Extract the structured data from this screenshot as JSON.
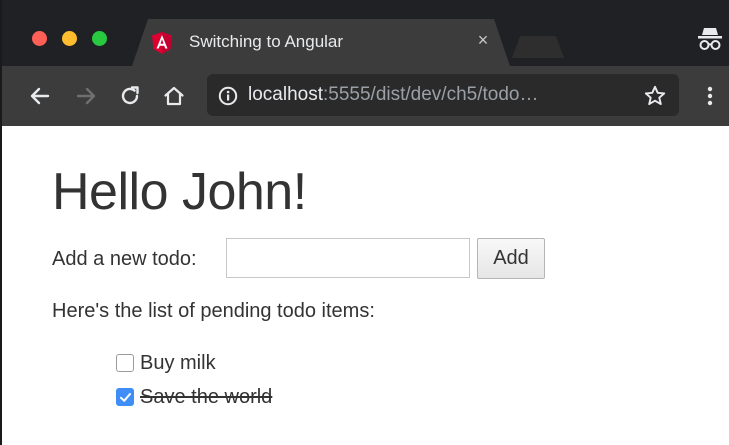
{
  "browser": {
    "tab": {
      "title": "Switching to Angular",
      "close_glyph": "×",
      "favicon": "angular-icon"
    },
    "address_bar": {
      "host": "localhost",
      "rest": ":5555/dist/dev/ch5/todo…"
    },
    "colors": {
      "tab_strip": "#202124",
      "toolbar": "#3c3c3c",
      "angular_red": "#dd0031"
    }
  },
  "page": {
    "heading": "Hello John!",
    "add_label": "Add a new todo:",
    "input_value": "",
    "add_button": "Add",
    "list_heading": "Here's the list of pending todo items:",
    "todos": [
      {
        "label": "Buy milk",
        "completed": false
      },
      {
        "label": "Save the world",
        "completed": true
      }
    ],
    "colors": {
      "text": "#333333",
      "checkbox_checked": "#3f8ef7"
    }
  }
}
